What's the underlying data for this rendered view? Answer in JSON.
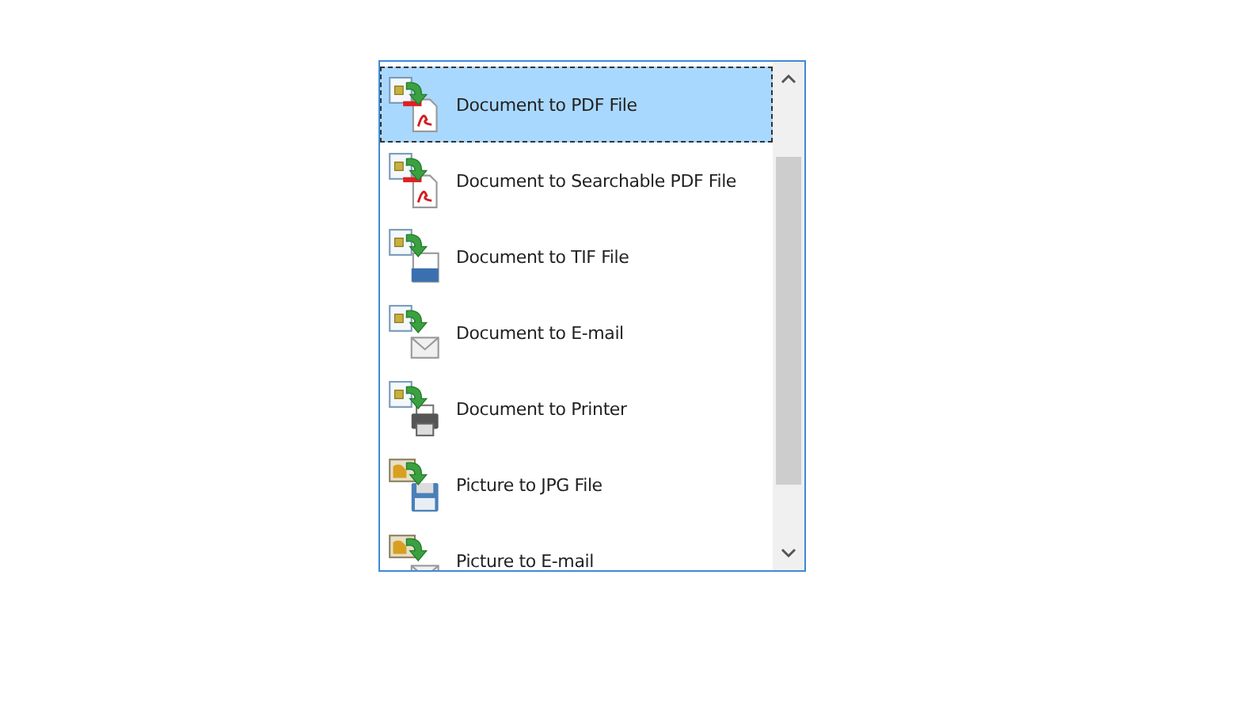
{
  "list": {
    "items": [
      {
        "label": "Document to PDF File",
        "kind": "pdf",
        "selected": true
      },
      {
        "label": "Document to Searchable PDF File",
        "kind": "pdf",
        "selected": false
      },
      {
        "label": "Document to TIF File",
        "kind": "tif",
        "selected": false
      },
      {
        "label": "Document to E-mail",
        "kind": "mail",
        "selected": false
      },
      {
        "label": "Document to Printer",
        "kind": "printer",
        "selected": false
      },
      {
        "label": "Picture to JPG File",
        "kind": "jpg",
        "selected": false
      },
      {
        "label": "Picture to E-mail",
        "kind": "picturemail",
        "selected": false
      }
    ]
  }
}
